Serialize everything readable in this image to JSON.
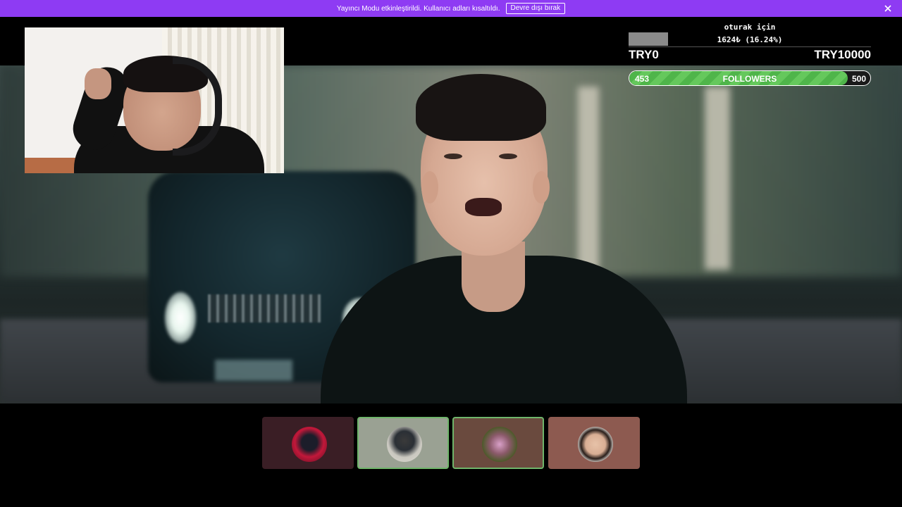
{
  "banner": {
    "message": "Yayıncı Modu etkinleştirildi. Kullanıcı adları kısaltıldı.",
    "button_label": "Devre dışı bırak",
    "color": "#8e3bf3"
  },
  "goal": {
    "title": "oturak için",
    "amount": "1624₺ (16.24%)",
    "min_label": "TRY0",
    "max_label": "TRY10000",
    "progress": 0.1624
  },
  "followers": {
    "current": "453",
    "label": "FOLLOWERS",
    "target": "500",
    "progress": 0.906,
    "color": "#4fb54a"
  },
  "cards": [
    {
      "name": "card-1",
      "bg": "#3a1e25",
      "border": "#3a1e25",
      "avatar": "red-figure-avatar"
    },
    {
      "name": "card-2",
      "bg": "#9aa193",
      "border": "#6fb56a",
      "avatar": "man-avatar"
    },
    {
      "name": "card-3",
      "bg": "#6a4a3e",
      "border": "#6fb56a",
      "avatar": "lights-avatar"
    },
    {
      "name": "card-4",
      "bg": "#8d5a50",
      "border": "#8d5a50",
      "avatar": "mustache-man-avatar"
    }
  ]
}
